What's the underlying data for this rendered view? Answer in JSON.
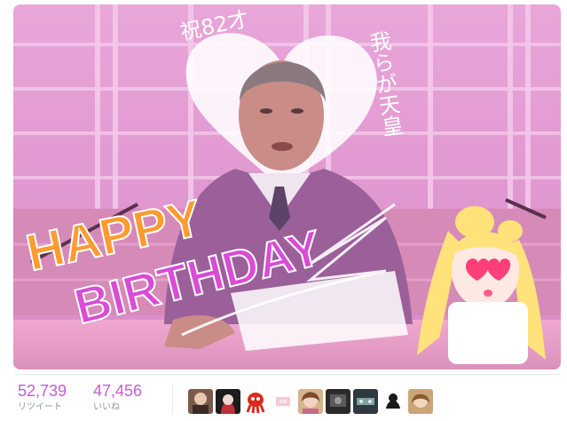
{
  "photo": {
    "overlay_text": {
      "left_handwriting": "祝82才",
      "right_handwriting": "我らが天皇",
      "banner_line1": "HAPPY",
      "banner_line2": "BIRTHDAY"
    }
  },
  "stats": {
    "retweets": {
      "value": "52,739",
      "label": "リツイート"
    },
    "likes": {
      "value": "47,456",
      "label": "いいね"
    }
  },
  "avatars": [
    "user-avatar-1",
    "user-avatar-2",
    "user-avatar-3",
    "user-avatar-4",
    "user-avatar-5",
    "user-avatar-6",
    "user-avatar-7",
    "user-avatar-8",
    "user-avatar-9"
  ],
  "colors": {
    "accent": "#bf5fd6",
    "muted": "#8899a6"
  }
}
